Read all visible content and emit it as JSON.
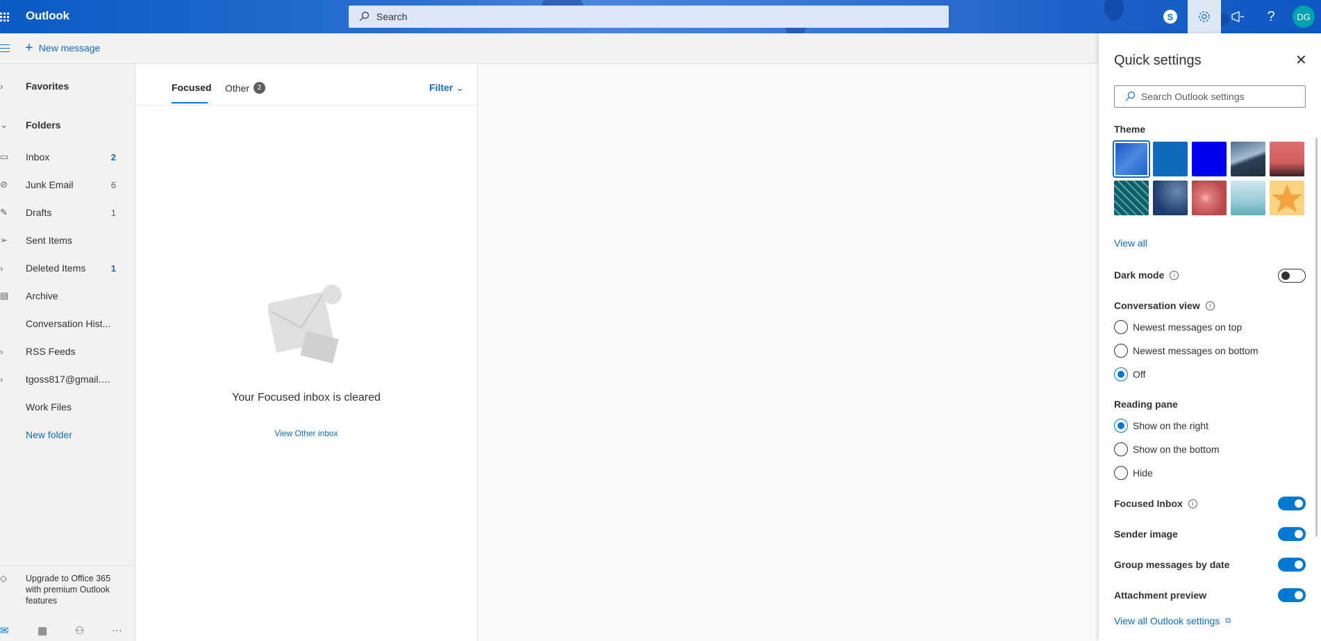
{
  "header": {
    "app_name": "Outlook",
    "search_placeholder": "Search",
    "avatar_initials": "DG",
    "accent": "#0078d4"
  },
  "command_bar": {
    "new_message_label": "New message"
  },
  "nav": {
    "favorites_label": "Favorites",
    "folders_label": "Folders",
    "folders": [
      {
        "label": "Inbox",
        "count": "2",
        "icon": "inbox-icon"
      },
      {
        "label": "Junk Email",
        "count": "6",
        "icon": "junk-icon"
      },
      {
        "label": "Drafts",
        "count": "1",
        "icon": "pencil-icon"
      },
      {
        "label": "Sent Items",
        "count": "",
        "icon": "send-icon"
      },
      {
        "label": "Deleted Items",
        "count": "1",
        "icon": "trash-icon"
      },
      {
        "label": "Archive",
        "count": "",
        "icon": "archive-icon"
      },
      {
        "label": "Conversation Hist...",
        "count": "",
        "icon": ""
      },
      {
        "label": "RSS Feeds",
        "count": "",
        "icon": "chevron-right-icon"
      },
      {
        "label": "tgoss817@gmail.c...",
        "count": "",
        "icon": "chevron-right-icon"
      },
      {
        "label": "Work Files",
        "count": "",
        "icon": ""
      }
    ],
    "new_folder_label": "New folder",
    "upgrade_text": "Upgrade to Office 365 with premium Outlook features"
  },
  "message_list": {
    "tab_focused": "Focused",
    "tab_other": "Other",
    "other_count": "2",
    "filter_label": "Filter",
    "empty_title": "Your Focused inbox is cleared",
    "empty_link": "View Other inbox"
  },
  "quick_settings": {
    "title": "Quick settings",
    "search_placeholder": "Search Outlook settings",
    "theme_label": "Theme",
    "view_all_label": "View all",
    "dark_mode_label": "Dark mode",
    "dark_mode_on": false,
    "conversation_view_label": "Conversation view",
    "conversation_options": [
      "Newest messages on top",
      "Newest messages on bottom",
      "Off"
    ],
    "conversation_selected": "Off",
    "reading_pane_label": "Reading pane",
    "reading_pane_options": [
      "Show on the right",
      "Show on the bottom",
      "Hide"
    ],
    "reading_pane_selected": "Show on the right",
    "focused_inbox_label": "Focused Inbox",
    "focused_inbox_on": true,
    "sender_image_label": "Sender image",
    "sender_image_on": true,
    "group_by_date_label": "Group messages by date",
    "group_by_date_on": true,
    "attachment_preview_label": "Attachment preview",
    "attachment_preview_on": true,
    "view_all_settings_label": "View all Outlook settings"
  }
}
